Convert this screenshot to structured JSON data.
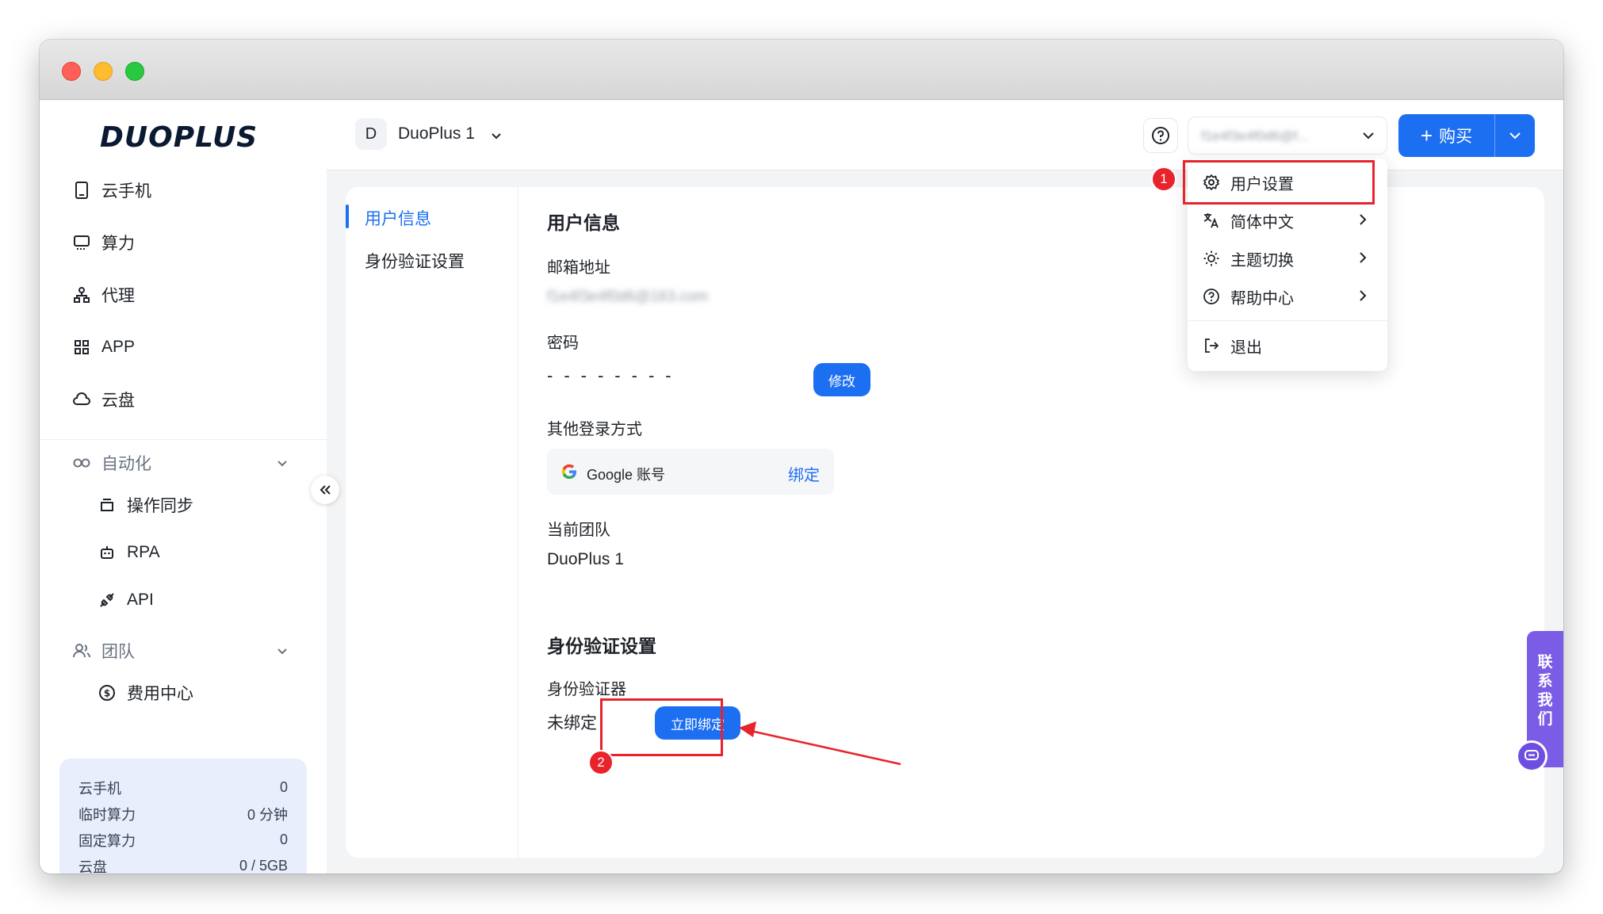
{
  "brand": {
    "logo_text": "DUOPLUS",
    "accent_color": "#1d6ff2"
  },
  "sidebar": {
    "items": [
      {
        "label": "云手机",
        "icon": "phone-icon"
      },
      {
        "label": "算力",
        "icon": "monitor-icon"
      },
      {
        "label": "代理",
        "icon": "network-icon"
      },
      {
        "label": "APP",
        "icon": "grid-icon"
      },
      {
        "label": "云盘",
        "icon": "cloud-icon"
      }
    ],
    "automation": {
      "label": "自动化",
      "children": [
        {
          "label": "操作同步"
        },
        {
          "label": "RPA"
        },
        {
          "label": "API"
        }
      ]
    },
    "team": {
      "label": "团队",
      "children": [
        {
          "label": "费用中心"
        }
      ]
    },
    "stats": [
      {
        "label": "云手机",
        "value": "0"
      },
      {
        "label": "临时算力",
        "value": "0 分钟"
      },
      {
        "label": "固定算力",
        "value": "0"
      },
      {
        "label": "云盘",
        "value": "0 / 5GB"
      }
    ]
  },
  "header": {
    "team_initial": "D",
    "team_name": "DuoPlus 1",
    "user_email": "f1e4f3e4f0d6@f...",
    "buy_label": "购买"
  },
  "subnav": {
    "items": [
      {
        "label": "用户信息"
      },
      {
        "label": "身份验证设置"
      }
    ]
  },
  "user_info": {
    "title": "用户信息",
    "email_label": "邮箱地址",
    "email_value": "f1e4f3e4f0d6@163.com",
    "password_label": "密码",
    "password_mask": "--------",
    "edit_label": "修改",
    "other_login_label": "其他登录方式",
    "google_label": "Google 账号",
    "bind_label": "绑定",
    "team_label": "当前团队",
    "team_value": "DuoPlus 1"
  },
  "auth": {
    "title": "身份验证设置",
    "authenticator_label": "身份验证器",
    "status": "未绑定",
    "bind_now_label": "立即绑定"
  },
  "menu": {
    "items": [
      {
        "label": "用户设置",
        "icon": "gear-icon"
      },
      {
        "label": "简体中文",
        "icon": "translate-icon"
      },
      {
        "label": "主题切换",
        "icon": "sun-icon"
      },
      {
        "label": "帮助中心",
        "icon": "help-circle-icon"
      },
      {
        "label": "退出",
        "icon": "logout-icon"
      }
    ]
  },
  "annotations": {
    "badge1": "1",
    "badge2": "2",
    "color": "#e8232c"
  },
  "contact": {
    "label_chars": [
      "联",
      "系",
      "我",
      "们"
    ]
  }
}
